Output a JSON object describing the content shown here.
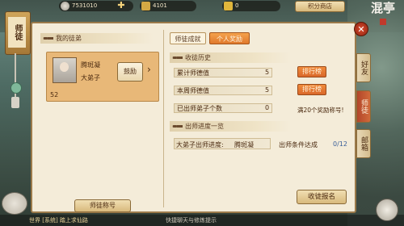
{
  "topbar": {
    "silver": "7531010",
    "gold": "4101",
    "ingot": "0",
    "shop_label": "积分商店"
  },
  "banner": {
    "title": "师徒"
  },
  "left": {
    "section_title": "我的徒弟",
    "disciple": {
      "name": "腾斑凝",
      "rank": "大弟子",
      "level": "52",
      "encourage_label": "鼓励"
    },
    "title_button": "师徒称号"
  },
  "tabs": [
    {
      "label": "师徒成就"
    },
    {
      "label": "个人奖励"
    }
  ],
  "history": {
    "title": "收徒历史",
    "rows": [
      {
        "label": "累计师德值",
        "value": "5"
      },
      {
        "label": "本周师德值",
        "value": "5"
      },
      {
        "label": "已出师弟子个数",
        "value": "0"
      }
    ],
    "rank_button": "排行榜",
    "reward_note": "满20个奖励称号!"
  },
  "progress": {
    "title": "出师进度一览",
    "label": "大弟子出师进度:",
    "name": "腾斑凝",
    "cond_label": "出师条件达成",
    "cond_value": "0/12"
  },
  "signup_button": "收徒报名",
  "side_tabs": [
    {
      "label": "好友"
    },
    {
      "label": "师徒"
    },
    {
      "label": "邮箱"
    }
  ],
  "logo": {
    "text": "混亭"
  },
  "chat": {
    "left": "世界 [系统] 踏上求仙路",
    "mid": "快捷聊天与修炼提示"
  }
}
